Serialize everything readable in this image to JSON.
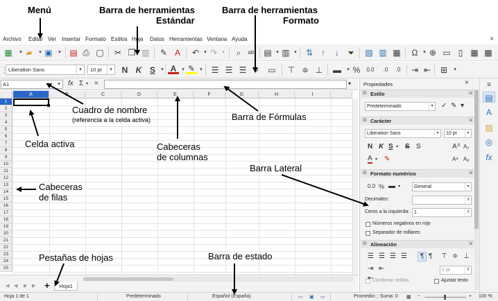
{
  "callouts": {
    "menu": "Menú",
    "std_line1": "Barra de herramientas",
    "std_line2": "Estándar",
    "fmt_line1": "Barra de herramientas",
    "fmt_line2": "Formato",
    "namebox_line1": "Cuadro de nombre",
    "namebox_line2": "(referencia a la celda activa)",
    "formula_bar": "Barra de Fórmulas",
    "active_cell": "Celda activa",
    "col_headers_line1": "Cabeceras",
    "col_headers_line2": "de columnas",
    "sidebar": "Barra Lateral",
    "row_headers_line1": "Cabeceras",
    "row_headers_line2": "de filas",
    "sheet_tabs": "Pestañas de hojas",
    "status_bar": "Barra de estado"
  },
  "menu": [
    "Archivo",
    "Editar",
    "Ver",
    "Insertar",
    "Formato",
    "Estilos",
    "Hoja",
    "Datos",
    "Herramientas",
    "Ventana",
    "Ayuda"
  ],
  "menu_close": "×",
  "formatting": {
    "font_name": "Liberation Sans",
    "font_size": "10 pt",
    "bold": "N",
    "italic": "K",
    "underline": "S",
    "font_color_letter": "A",
    "percent": "%",
    "number_format": "0.0"
  },
  "formula_bar": {
    "cell_ref": "A1",
    "fx": "fx",
    "sum": "Σ",
    "equals": "="
  },
  "grid": {
    "columns": [
      "A",
      "B",
      "C",
      "D",
      "E",
      "F",
      "G",
      "H",
      "I"
    ],
    "rows": [
      "1",
      "2",
      "3",
      "4",
      "5",
      "6",
      "7",
      "8",
      "9",
      "10",
      "11",
      "12",
      "13",
      "14",
      "15",
      "16",
      "17",
      "18",
      "19",
      "20",
      "21",
      "22",
      "23",
      "24",
      "25"
    ]
  },
  "sheets": {
    "add": "+",
    "tabs": [
      "Hoja1"
    ]
  },
  "status": {
    "sheet_pos": "Hoja 1 de 1",
    "page_style": "Predeterminado",
    "language": "Español (España)",
    "stats": "Promedio: ; Suma: 0",
    "zoom": "100 %",
    "zoom_minus": "−",
    "zoom_plus": "+"
  },
  "sidebar": {
    "title": "Propiedades",
    "close": "×",
    "style": {
      "header": "Estilo",
      "value": "Predeterminado"
    },
    "character": {
      "header": "Carácter",
      "font": "Liberation Sans",
      "size": "10 pt",
      "bold": "N",
      "italic": "K",
      "underline": "S",
      "strike": "S",
      "shadow": "S"
    },
    "number_format": {
      "header": "Formato numérico",
      "category": "General",
      "decimals_label": "Decimales:",
      "leading_zeros_label": "Ceros a la izquierda:",
      "leading_zeros_value": "1",
      "negative_red": "Números negativos en rojo",
      "thousands_sep": "Separador de millares"
    },
    "alignment": {
      "header": "Alineación",
      "indent_value": "0 pt",
      "merge_cells": "Combinar celdas",
      "wrap_text": "Ajustar texto"
    }
  },
  "colors": {
    "accent": "#2a67c7",
    "toolbar_bg": "#f3f3f3",
    "font_color": "#c9211e",
    "highlight": "#ffff00"
  }
}
